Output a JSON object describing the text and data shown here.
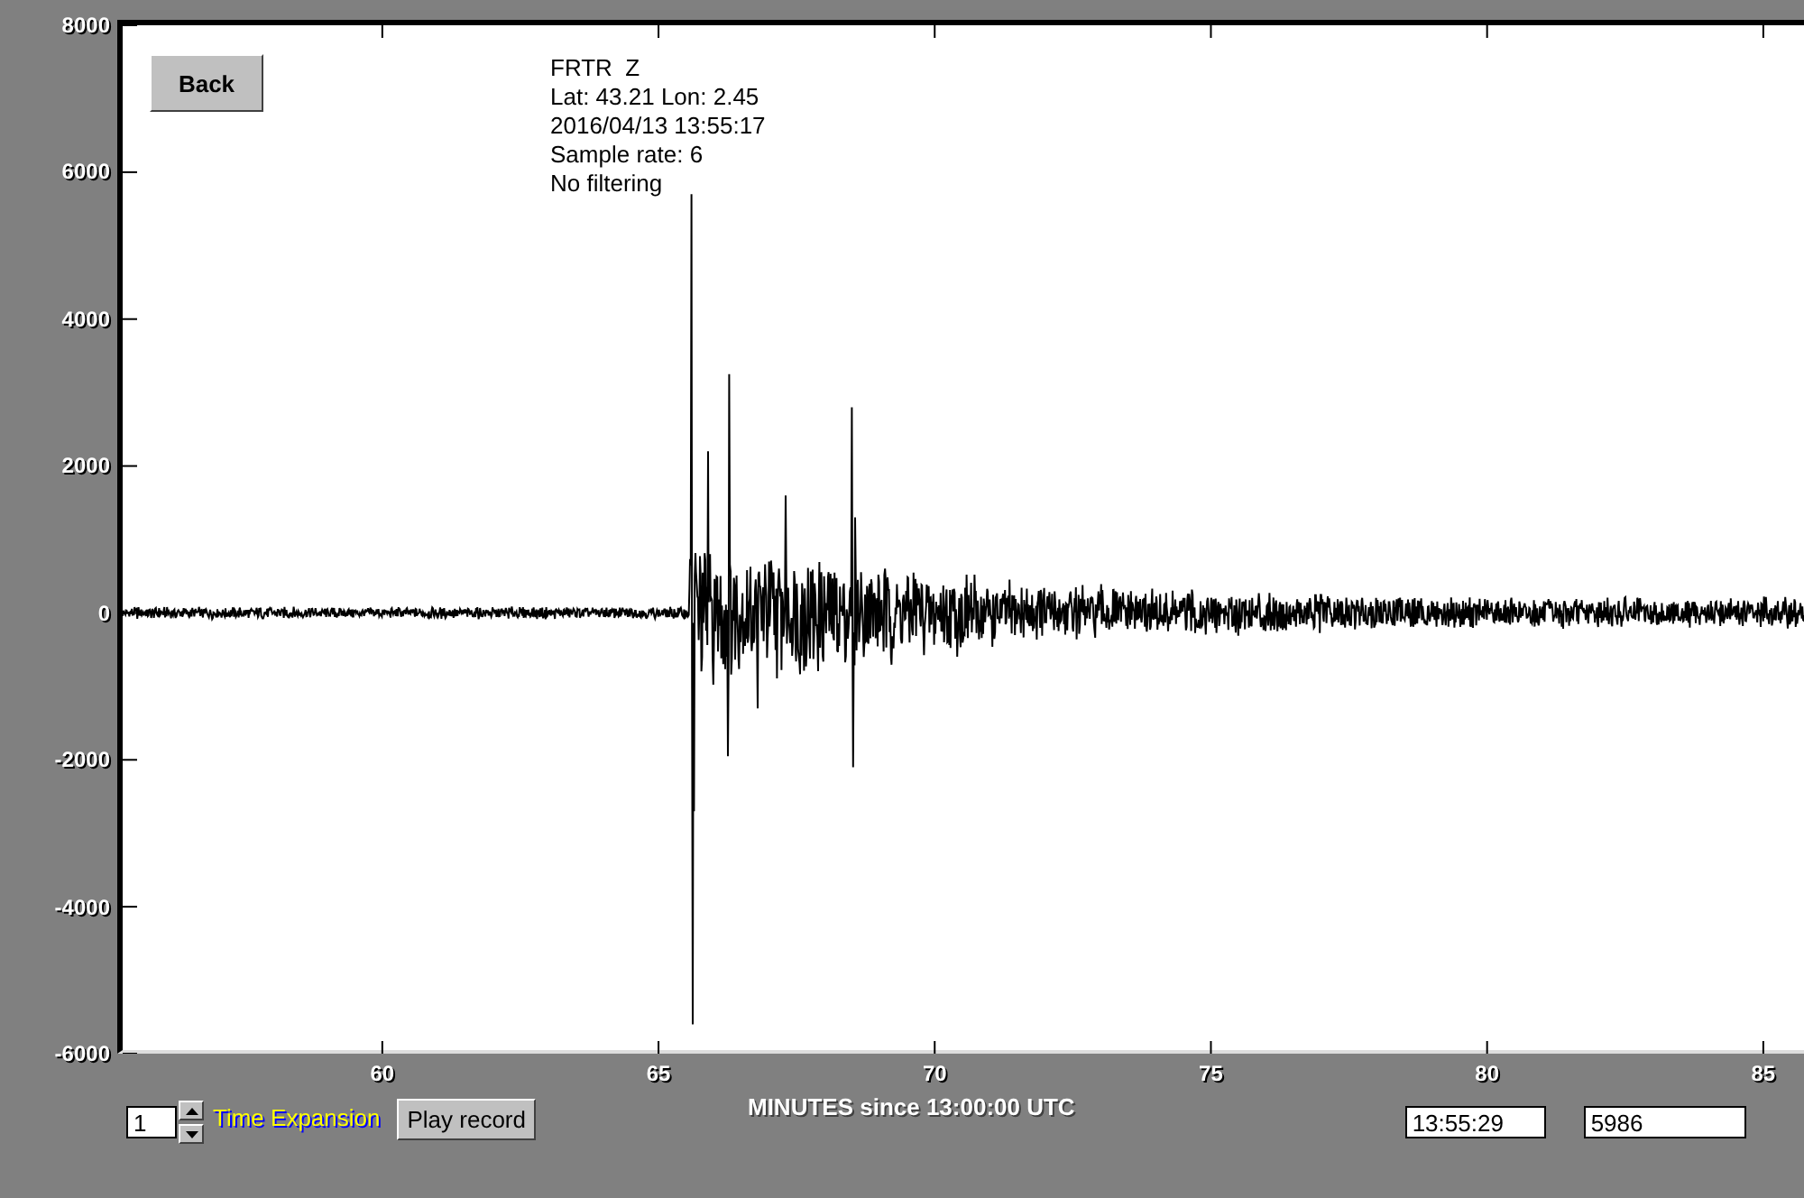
{
  "back_button": "Back",
  "info_lines": [
    "FRTR  Z",
    "Lat: 43.21 Lon: 2.45",
    "2016/04/13 13:55:17",
    "Sample rate: 6",
    "No filtering"
  ],
  "y_axis_labels": [
    "8000",
    "6000",
    "4000",
    "2000",
    "0",
    "-2000",
    "-4000",
    "-6000"
  ],
  "x_axis_labels": [
    "60",
    "65",
    "70",
    "75",
    "80",
    "85"
  ],
  "x_axis_title": "MINUTES since 13:00:00 UTC",
  "expansion": {
    "value": "1",
    "label": "Time Expansion"
  },
  "play_button": "Play record",
  "time_field": "13:55:29",
  "count_field": "5986"
}
